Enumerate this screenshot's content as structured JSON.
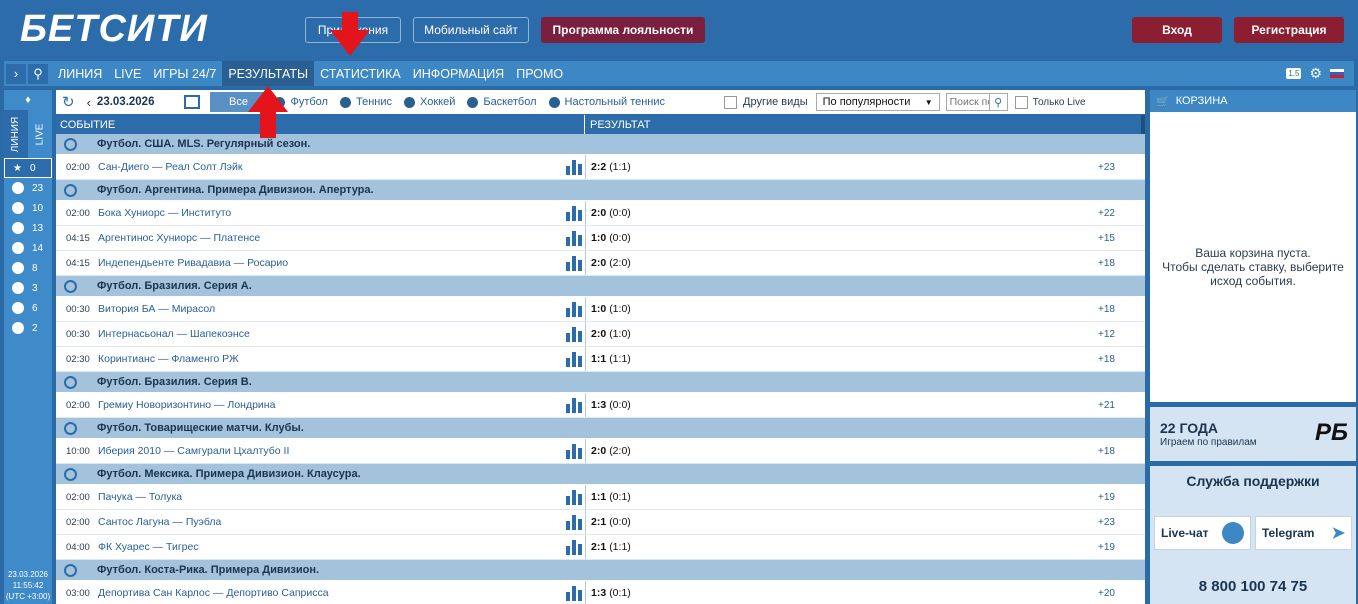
{
  "header": {
    "logo": "БЕТСИТИ",
    "buttons": [
      "Приложения",
      "Мобильный сайт",
      "Программа лояльности"
    ],
    "login": "Вход",
    "register": "Регистрация"
  },
  "nav": {
    "items": [
      "ЛИНИЯ",
      "LIVE",
      "ИГРЫ 24/7",
      "РЕЗУЛЬТАТЫ",
      "СТАТИСТИКА",
      "ИНФОРМАЦИЯ",
      "ПРОМО"
    ],
    "active": "РЕЗУЛЬТАТЫ",
    "badge": "1.5"
  },
  "sidebar": {
    "tabs": [
      "ЛИНИЯ",
      "LIVE"
    ],
    "favorites_count": "0",
    "sports": [
      {
        "icon": "football-icon",
        "count": "23"
      },
      {
        "icon": "tennis-icon",
        "count": "10"
      },
      {
        "icon": "hockey-icon",
        "count": "13"
      },
      {
        "icon": "basketball-icon",
        "count": "14"
      },
      {
        "icon": "table-tennis-icon",
        "count": "8"
      },
      {
        "icon": "volleyball-icon",
        "count": "3"
      },
      {
        "icon": "esports-icon",
        "count": "6"
      },
      {
        "icon": "other-icon",
        "count": "2"
      }
    ],
    "clock_date": "23.03.2026",
    "clock_time": "11:55:42",
    "clock_tz": "(UTC +3:00)"
  },
  "filters": {
    "date": "23.03.2026",
    "all_button": "Все",
    "sports": [
      "Футбол",
      "Теннис",
      "Хоккей",
      "Баскетбол",
      "Настольный теннис"
    ],
    "other": "Другие виды",
    "sort": "По популярности",
    "search_placeholder": "Поиск по",
    "live_only": "Только Live"
  },
  "table": {
    "col_event": "СОБЫТИЕ",
    "col_result": "РЕЗУЛЬТАТ",
    "groups": [
      {
        "title": "Футбол. США. MLS. Регулярный сезон.",
        "rows": [
          {
            "time": "02:00",
            "teams": "Сан-Диего — Реал Солт Лэйк",
            "score": "2:2",
            "half": "(1:1)",
            "more": "+23"
          }
        ]
      },
      {
        "title": "Футбол. Аргентина. Примера Дивизион. Апертура.",
        "rows": [
          {
            "time": "02:00",
            "teams": "Бока Хуниорс — Институто",
            "score": "2:0",
            "half": "(0:0)",
            "more": "+22"
          },
          {
            "time": "04:15",
            "teams": "Аргентинос Хуниорс — Платенсе",
            "score": "1:0",
            "half": "(0:0)",
            "more": "+15"
          },
          {
            "time": "04:15",
            "teams": "Индепендьенте Ривадавиа — Росарио",
            "score": "2:0",
            "half": "(2:0)",
            "more": "+18"
          }
        ]
      },
      {
        "title": "Футбол. Бразилия. Серия A.",
        "rows": [
          {
            "time": "00:30",
            "teams": "Витория БА — Мирасол",
            "score": "1:0",
            "half": "(1:0)",
            "more": "+18"
          },
          {
            "time": "00:30",
            "teams": "Интернасьонал — Шапекоэнсе",
            "score": "2:0",
            "half": "(1:0)",
            "more": "+12"
          },
          {
            "time": "02:30",
            "teams": "Коринтианс — Фламенго РЖ",
            "score": "1:1",
            "half": "(1:1)",
            "more": "+18"
          }
        ]
      },
      {
        "title": "Футбол. Бразилия. Серия B.",
        "rows": [
          {
            "time": "02:00",
            "teams": "Гремиу Новоризонтино — Лондрина",
            "score": "1:3",
            "half": "(0:0)",
            "more": "+21"
          }
        ]
      },
      {
        "title": "Футбол. Товарищеские матчи. Клубы.",
        "rows": [
          {
            "time": "10:00",
            "teams": "Иберия 2010 — Самгурали Цхалтубо II",
            "score": "2:0",
            "half": "(2:0)",
            "more": "+18"
          }
        ]
      },
      {
        "title": "Футбол. Мексика. Примера Дивизион. Клаусура.",
        "rows": [
          {
            "time": "02:00",
            "teams": "Пачука — Толука",
            "score": "1:1",
            "half": "(0:1)",
            "more": "+19"
          },
          {
            "time": "02:00",
            "teams": "Сантос Лагуна — Пуэбла",
            "score": "2:1",
            "half": "(0:0)",
            "more": "+23"
          },
          {
            "time": "04:00",
            "teams": "ФК Хуарес — Тигрес",
            "score": "2:1",
            "half": "(1:1)",
            "more": "+19"
          }
        ]
      },
      {
        "title": "Футбол. Коста-Рика. Примера Дивизион.",
        "rows": [
          {
            "time": "03:00",
            "teams": "Депортива Сан Карлос — Депортиво Саприсса",
            "score": "1:3",
            "half": "(0:1)",
            "more": "+20"
          }
        ]
      }
    ]
  },
  "cart": {
    "title": "КОРЗИНА",
    "empty_line1": "Ваша корзина пуста.",
    "empty_line2": "Чтобы сделать ставку, выберите",
    "empty_line3": "исход события."
  },
  "promo": {
    "years": "22 ГОДА",
    "slogan": "Играем по правилам",
    "logo": "РБ"
  },
  "support": {
    "title": "Служба поддержки",
    "chat": "Live-чат",
    "telegram": "Telegram",
    "phone": "8 800 100 74 75"
  },
  "colors": {
    "header_bg": "#2d6cab",
    "nav_bg": "#3d87c4",
    "loyalty": "#7a1f3d",
    "auth": "#8c1e32",
    "group_bg": "#a3c2dc",
    "arrow": "#e3141b"
  }
}
